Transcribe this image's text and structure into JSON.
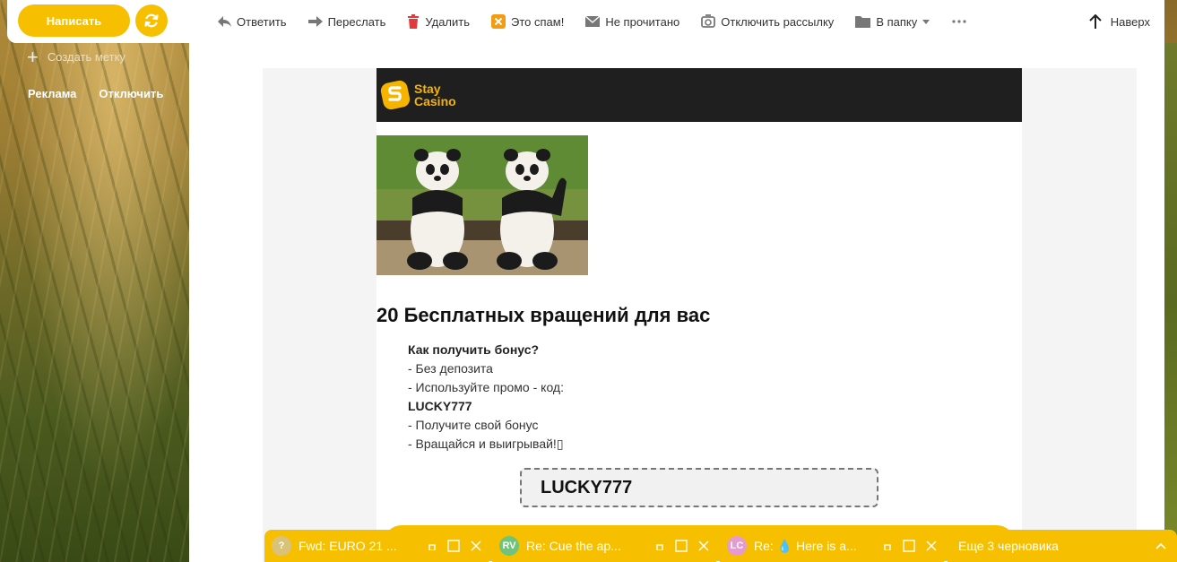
{
  "header": {
    "compose_label": "Написать",
    "toolbar": [
      {
        "name": "reply",
        "label": "Ответить",
        "icon": "reply-icon"
      },
      {
        "name": "forward",
        "label": "Переслать",
        "icon": "forward-icon"
      },
      {
        "name": "delete",
        "label": "Удалить",
        "icon": "trash-icon"
      },
      {
        "name": "spam",
        "label": "Это спам!",
        "icon": "spam-icon"
      },
      {
        "name": "unread",
        "label": "Не прочитано",
        "icon": "envelope-icon"
      },
      {
        "name": "unsubscribe",
        "label": "Отключить рассылку",
        "icon": "unsubscribe-icon"
      },
      {
        "name": "to-folder",
        "label": "В папку",
        "icon": "folder-icon"
      }
    ],
    "up_label": "Наверх"
  },
  "sidebar": {
    "create_label": "Создать метку",
    "ad_label": "Реклама",
    "ad_disable": "Отключить"
  },
  "email": {
    "brand_line1": "Stay",
    "brand_line2": "Casino",
    "headline": "20 Бесплатных вращений для вас",
    "steps": [
      "Как получить бонус?",
      "- Без депозита",
      "- Используйте промо - код:",
      "LUCKY777",
      "- Получите свой бонус",
      "- Вращайся и выигрывай!▯"
    ],
    "promo_code": "LUCKY777"
  },
  "drafts": [
    {
      "avatar": "?",
      "avatar_color": "#d9c27a",
      "title": "Fwd: EURO 21 ..."
    },
    {
      "avatar": "RV",
      "avatar_color": "#6fc37a",
      "title": "Re: Cue the ap..."
    },
    {
      "avatar": "LC",
      "avatar_color": "#e59ad0",
      "title": "Re: 💧 Here is a..."
    }
  ],
  "more_drafts_label": "Еще 3 черновика",
  "colors": {
    "accent": "#f6c000",
    "brand_bar": "#1f1f1f"
  }
}
